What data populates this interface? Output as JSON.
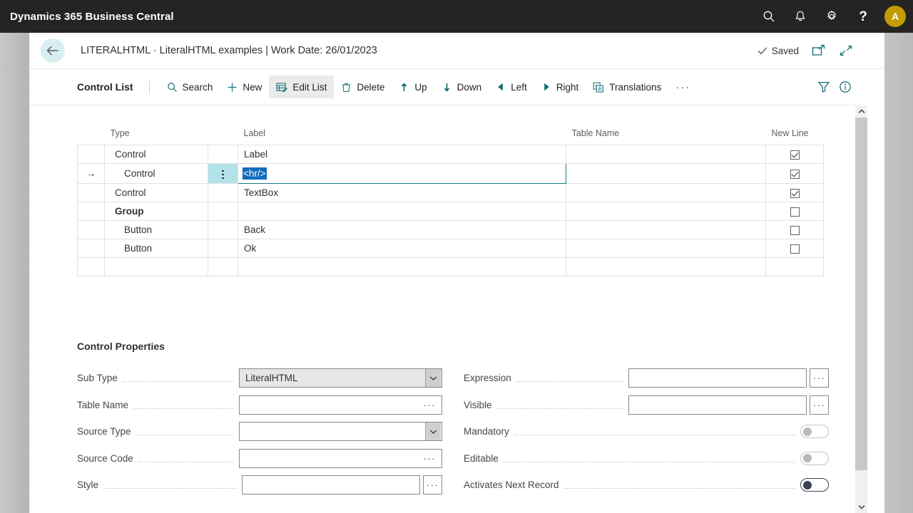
{
  "appbar": {
    "title": "Dynamics 365 Business Central",
    "icons": [
      "search-icon",
      "notification-bell-icon",
      "settings-gear-icon",
      "help-question-icon"
    ],
    "avatar_initial": "A",
    "avatar_color": "#c19c00"
  },
  "titlebar": {
    "back_label": "Back",
    "page_title": "LITERALHTML · LiteralHTML examples | Work Date: 26/01/2023",
    "saved_label": "Saved",
    "open_new_window_label": "Open in new window",
    "collapse_label": "Collapse"
  },
  "commandbar": {
    "list_title": "Control List",
    "items": [
      {
        "label": "Search",
        "icon": "search-icon",
        "active": false
      },
      {
        "label": "New",
        "icon": "plus-icon",
        "active": false
      },
      {
        "label": "Edit List",
        "icon": "edit-list-icon",
        "active": true
      },
      {
        "label": "Delete",
        "icon": "trash-icon",
        "active": false
      },
      {
        "label": "Up",
        "icon": "arrow-up-icon",
        "active": false
      },
      {
        "label": "Down",
        "icon": "arrow-down-icon",
        "active": false
      },
      {
        "label": "Left",
        "icon": "triangle-left-icon",
        "active": false
      },
      {
        "label": "Right",
        "icon": "triangle-right-icon",
        "active": false
      },
      {
        "label": "Translations",
        "icon": "translations-icon",
        "active": false
      }
    ],
    "overflow_label": "···",
    "filter_label": "Filter",
    "info_label": "Info",
    "accent_color": "#0f6c75"
  },
  "grid": {
    "columns": [
      "",
      "Type",
      "",
      "Label",
      "Table Name",
      "New Line"
    ],
    "rows": [
      {
        "indicator": "",
        "type": "Control",
        "indent": 0,
        "bold": false,
        "label": "Label",
        "table_name": "",
        "new_line": true,
        "selected": false,
        "editing": false
      },
      {
        "indicator": "→",
        "type": "Control",
        "indent": 1,
        "bold": false,
        "label": "<hr/>",
        "table_name": "",
        "new_line": true,
        "selected": true,
        "editing": true
      },
      {
        "indicator": "",
        "type": "Control",
        "indent": 0,
        "bold": false,
        "label": "TextBox",
        "table_name": "",
        "new_line": true,
        "selected": false,
        "editing": false
      },
      {
        "indicator": "",
        "type": "Group",
        "indent": 0,
        "bold": true,
        "label": "",
        "table_name": "",
        "new_line": false,
        "selected": false,
        "editing": false
      },
      {
        "indicator": "",
        "type": "Button",
        "indent": 1,
        "bold": false,
        "label": "Back",
        "table_name": "",
        "new_line": false,
        "selected": false,
        "editing": false
      },
      {
        "indicator": "",
        "type": "Button",
        "indent": 1,
        "bold": false,
        "label": "Ok",
        "table_name": "",
        "new_line": false,
        "selected": false,
        "editing": false
      },
      {
        "indicator": "",
        "type": "",
        "indent": 0,
        "bold": false,
        "label": "",
        "table_name": "",
        "new_line": null,
        "selected": false,
        "editing": false
      }
    ]
  },
  "properties": {
    "section_title": "Control Properties",
    "left": [
      {
        "label": "Sub Type",
        "value": "LiteralHTML",
        "control": "dropdown",
        "focused": true
      },
      {
        "label": "Table Name",
        "value": "",
        "control": "assist",
        "focused": false
      },
      {
        "label": "Source Type",
        "value": "",
        "control": "dropdown",
        "focused": false
      },
      {
        "label": "Source Code",
        "value": "",
        "control": "assist",
        "focused": false
      },
      {
        "label": "Style",
        "value": "",
        "control": "assist-external",
        "focused": false
      }
    ],
    "right": [
      {
        "label": "Expression",
        "value": "",
        "control": "assist-external",
        "toggle_on": null,
        "toggle_enabled": null
      },
      {
        "label": "Visible",
        "value": "",
        "control": "assist-external",
        "toggle_on": null,
        "toggle_enabled": null
      },
      {
        "label": "Mandatory",
        "value": "",
        "control": "toggle",
        "toggle_on": false,
        "toggle_enabled": false
      },
      {
        "label": "Editable",
        "value": "",
        "control": "toggle",
        "toggle_on": false,
        "toggle_enabled": false
      },
      {
        "label": "Activates Next Record",
        "value": "",
        "control": "toggle",
        "toggle_on": false,
        "toggle_enabled": true
      }
    ],
    "assist_dots": "···"
  },
  "scrollbar": {
    "up_label": "Scroll up",
    "down_label": "Scroll down"
  }
}
